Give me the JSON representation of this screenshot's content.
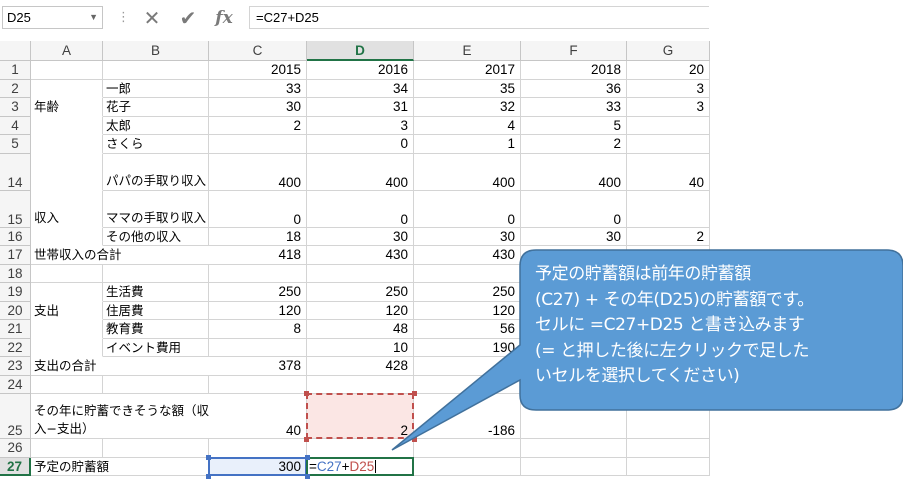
{
  "name_box": {
    "value": "D25"
  },
  "toolbar": {
    "cancel_glyph": "✕",
    "enter_glyph": "✔",
    "fx_label": "fx"
  },
  "formula_bar": {
    "value": "=C27+D25"
  },
  "columns": [
    "A",
    "B",
    "C",
    "D",
    "E",
    "F",
    "G"
  ],
  "selected_column": "D",
  "selected_row": "27",
  "rows": [
    {
      "num": "1",
      "a": "",
      "b": "",
      "c": "2015",
      "d": "2016",
      "e": "2017",
      "f": "2018",
      "g": "20"
    },
    {
      "num": "2",
      "a": "",
      "b": "一郎",
      "c": "33",
      "d": "34",
      "e": "35",
      "f": "36",
      "g": "3"
    },
    {
      "num": "3",
      "a": "年齢",
      "b": "花子",
      "c": "30",
      "d": "31",
      "e": "32",
      "f": "33",
      "g": "3"
    },
    {
      "num": "4",
      "a": "",
      "b": "太郎",
      "c": "2",
      "d": "3",
      "e": "4",
      "f": "5",
      "g": ""
    },
    {
      "num": "5",
      "a": "",
      "b": "さくら",
      "c": "",
      "d": "0",
      "e": "1",
      "f": "2",
      "g": ""
    },
    {
      "num": "14",
      "a": "",
      "b": "パパの手取り収入",
      "c": "400",
      "d": "400",
      "e": "400",
      "f": "400",
      "g": "40"
    },
    {
      "num": "15",
      "a": "収入",
      "b": "ママの手取り収入",
      "c": "0",
      "d": "0",
      "e": "0",
      "f": "0",
      "g": ""
    },
    {
      "num": "16",
      "a": "",
      "b": "その他の収入",
      "c": "18",
      "d": "30",
      "e": "30",
      "f": "30",
      "g": "2"
    },
    {
      "num": "17",
      "a": "世帯収入の合計",
      "b": "",
      "c": "418",
      "d": "430",
      "e": "430",
      "f": "430",
      "g": "4"
    },
    {
      "num": "18",
      "a": "",
      "b": "",
      "c": "",
      "d": "",
      "e": "",
      "f": "",
      "g": ""
    },
    {
      "num": "19",
      "a": "",
      "b": "生活費",
      "c": "250",
      "d": "250",
      "e": "250",
      "f": "",
      "g": ""
    },
    {
      "num": "20",
      "a": "支出",
      "b": "住居費",
      "c": "120",
      "d": "120",
      "e": "120",
      "f": "",
      "g": ""
    },
    {
      "num": "21",
      "a": "",
      "b": "教育費",
      "c": "8",
      "d": "48",
      "e": "56",
      "f": "",
      "g": ""
    },
    {
      "num": "22",
      "a": "",
      "b": "イベント費用",
      "c": "",
      "d": "10",
      "e": "190",
      "f": "",
      "g": ""
    },
    {
      "num": "23",
      "a": "支出の合計",
      "b": "",
      "c": "378",
      "d": "428",
      "e": "",
      "f": "",
      "g": ""
    },
    {
      "num": "24",
      "a": "",
      "b": "",
      "c": "",
      "d": "",
      "e": "",
      "f": "",
      "g": ""
    },
    {
      "num": "25",
      "a": "その年に貯蓄できそうな額（収入−支出）",
      "b": "",
      "c": "40",
      "d": "2",
      "e": "-186",
      "f": "",
      "g": ""
    },
    {
      "num": "26",
      "a": "",
      "b": "",
      "c": "",
      "d": "",
      "e": "",
      "f": "",
      "g": ""
    },
    {
      "num": "27",
      "a": "予定の貯蓄額",
      "b": "",
      "c": "300",
      "d": "",
      "e": "",
      "f": "",
      "g": ""
    }
  ],
  "editing_cell": {
    "parts": [
      "=",
      "C27",
      "+",
      "D25"
    ]
  },
  "callout": {
    "lines": [
      "予定の貯蓄額は前年の貯蓄額",
      "(C27) + その年(D25)の貯蓄額です。",
      "セルに =C27+D25 と書き込みます",
      "(= と押した後に左クリックで足した",
      "いセルを選択してください)"
    ]
  },
  "colors": {
    "accent": "#217346",
    "callout_fill": "#5b9bd5",
    "callout_border": "#41719c",
    "ref_blue": "#4472c4",
    "ref_red": "#c0504d"
  }
}
